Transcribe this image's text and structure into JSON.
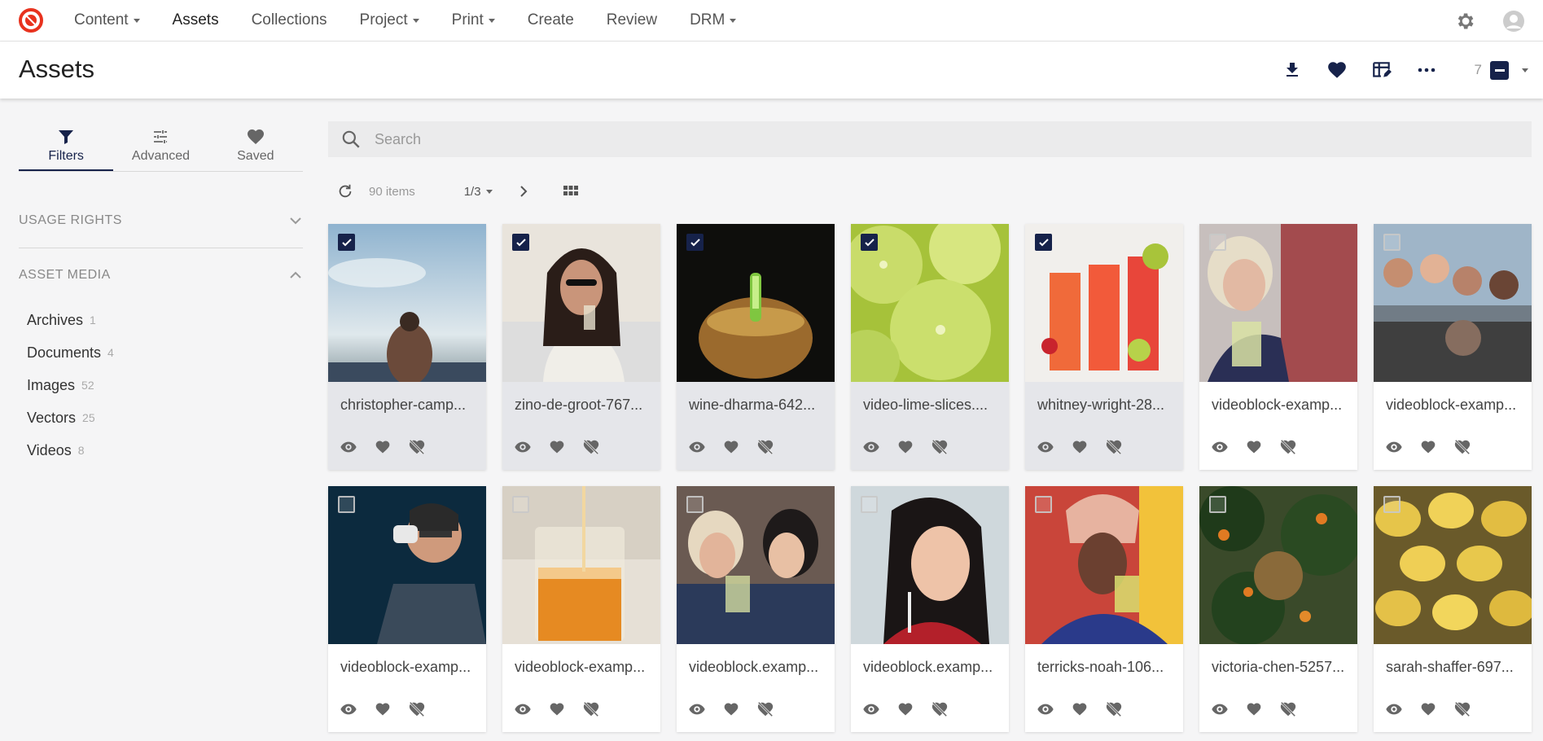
{
  "nav": {
    "items": [
      {
        "label": "Content",
        "dropdown": true
      },
      {
        "label": "Assets",
        "dropdown": false,
        "active": true
      },
      {
        "label": "Collections",
        "dropdown": false
      },
      {
        "label": "Project",
        "dropdown": true
      },
      {
        "label": "Print",
        "dropdown": true
      },
      {
        "label": "Create",
        "dropdown": false
      },
      {
        "label": "Review",
        "dropdown": false
      },
      {
        "label": "DRM",
        "dropdown": true
      }
    ],
    "brand_color": "#e8321e"
  },
  "header": {
    "title": "Assets",
    "selected_count": "7",
    "icons": [
      "download-icon",
      "heart-icon",
      "table-edit-icon",
      "more-icon"
    ]
  },
  "sidebar": {
    "tabs": [
      {
        "label": "Filters",
        "icon": "filter-icon",
        "active": true
      },
      {
        "label": "Advanced",
        "icon": "sliders-icon"
      },
      {
        "label": "Saved",
        "icon": "heart-icon"
      }
    ],
    "facets": [
      {
        "label": "USAGE RIGHTS",
        "expanded": false
      },
      {
        "label": "ASSET MEDIA",
        "expanded": true
      }
    ],
    "media_items": [
      {
        "name": "Archives",
        "count": "1"
      },
      {
        "name": "Documents",
        "count": "4"
      },
      {
        "name": "Images",
        "count": "52"
      },
      {
        "name": "Vectors",
        "count": "25"
      },
      {
        "name": "Videos",
        "count": "8"
      }
    ]
  },
  "search": {
    "placeholder": "Search"
  },
  "results": {
    "items_label": "90 items",
    "page": "1/3"
  },
  "accent_color": "#16224a",
  "cards": [
    {
      "name": "christopher-camp...",
      "selected": true,
      "thumb": "sky-beach"
    },
    {
      "name": "zino-de-groot-767...",
      "selected": true,
      "thumb": "woman-drink"
    },
    {
      "name": "wine-dharma-642...",
      "selected": true,
      "thumb": "copper-mug"
    },
    {
      "name": "video-lime-slices....",
      "selected": true,
      "thumb": "limes"
    },
    {
      "name": "whitney-wright-28...",
      "selected": true,
      "thumb": "red-drinks"
    },
    {
      "name": "videoblock-examp...",
      "selected": false,
      "thumb": "blonde-drink"
    },
    {
      "name": "videoblock-examp...",
      "selected": false,
      "thumb": "group-selfie"
    },
    {
      "name": "videoblock-examp...",
      "selected": false,
      "thumb": "man-drinking"
    },
    {
      "name": "videoblock-examp...",
      "selected": false,
      "thumb": "pouring-glass"
    },
    {
      "name": "videoblock.examp...",
      "selected": false,
      "thumb": "two-women"
    },
    {
      "name": "videoblock.examp...",
      "selected": false,
      "thumb": "brunette-straw"
    },
    {
      "name": "terricks-noah-106...",
      "selected": false,
      "thumb": "headwrap-woman"
    },
    {
      "name": "victoria-chen-5257...",
      "selected": false,
      "thumb": "orange-tree"
    },
    {
      "name": "sarah-shaffer-697...",
      "selected": false,
      "thumb": "lemons"
    }
  ]
}
